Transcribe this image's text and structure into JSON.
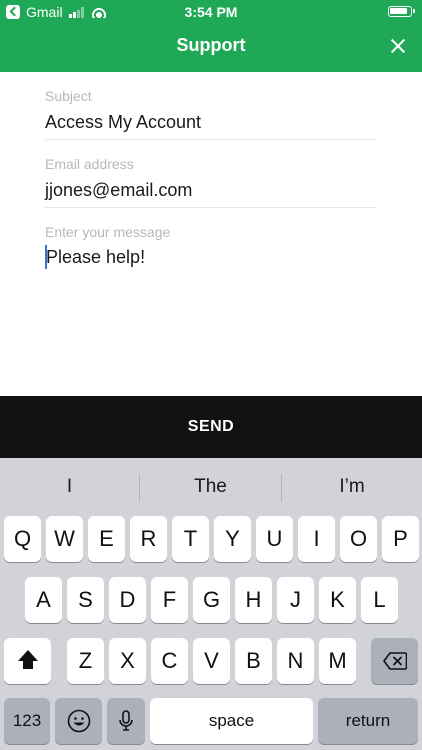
{
  "status_bar": {
    "carrier": "Gmail",
    "time": "3:54 PM"
  },
  "nav": {
    "title": "Support"
  },
  "form": {
    "subject": {
      "label": "Subject",
      "value": "Access My Account"
    },
    "email": {
      "label": "Email address",
      "value": "jjones@email.com"
    },
    "message": {
      "placeholder": "Enter your message",
      "value": "Please help!"
    }
  },
  "send_button": {
    "label": "SEND"
  },
  "keyboard": {
    "suggestions": [
      "I",
      "The",
      "I’m"
    ],
    "row1": [
      "Q",
      "W",
      "E",
      "R",
      "T",
      "Y",
      "U",
      "I",
      "O",
      "P"
    ],
    "row2": [
      "A",
      "S",
      "D",
      "F",
      "G",
      "H",
      "J",
      "K",
      "L"
    ],
    "row3": [
      "Z",
      "X",
      "C",
      "V",
      "B",
      "N",
      "M"
    ],
    "numbers_label": "123",
    "space_label": "space",
    "return_label": "return"
  },
  "colors": {
    "header": "#1fa855",
    "send_bar": "#121212",
    "keyboard_bg": "#d1d3d9",
    "caret": "#3b6fd8"
  },
  "icons": {
    "back": "back-to-app-icon",
    "signal": "cell-signal-icon",
    "wifi": "wifi-icon",
    "battery": "battery-icon",
    "close": "close-icon",
    "shift": "shift-icon",
    "delete": "delete-icon",
    "emoji": "emoji-icon",
    "mic": "microphone-icon"
  }
}
